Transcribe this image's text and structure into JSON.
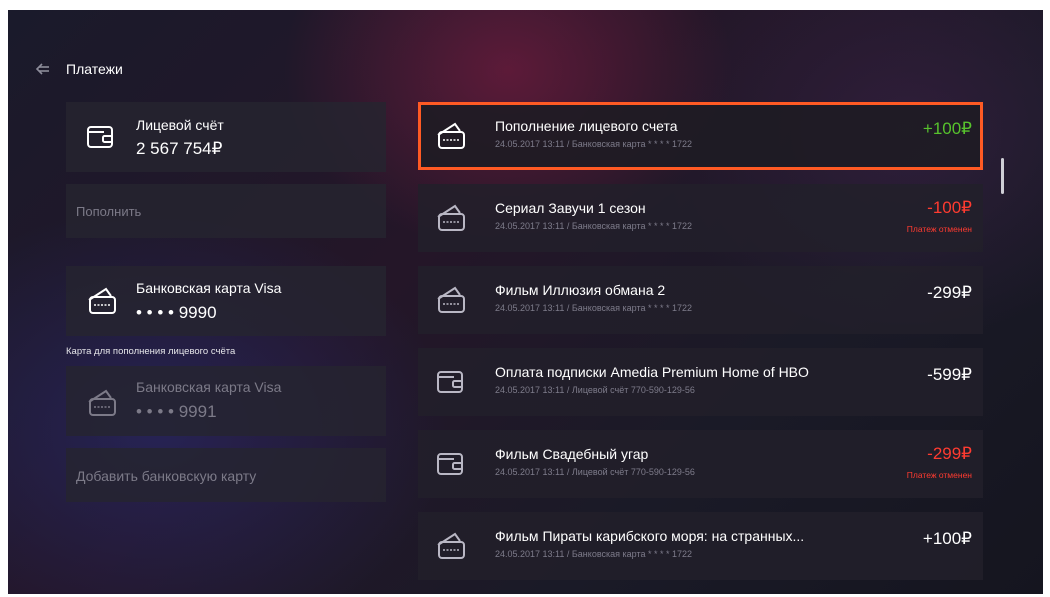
{
  "header": {
    "title": "Платежи"
  },
  "left": {
    "account": {
      "label": "Лицевой счёт",
      "balance": "2 567 754₽"
    },
    "topup_label": "Пополнить",
    "card_primary": {
      "name": "Банковская карта Visa",
      "number": "• • • • 9990"
    },
    "card_caption": "Карта для пополнения лицевого счёта",
    "card_secondary": {
      "name": "Банковская карта Visa",
      "number": "• • • • 9991"
    },
    "add_card_label": "Добавить банковскую карту"
  },
  "payments": [
    {
      "title": "Пополнение лицевого счета",
      "subtitle": "24.05.2017  13:11 / Банковская карта  * * * * 1722",
      "amount": "+100₽",
      "status": "",
      "icon": "bank-card-icon",
      "amount_color": "#57c22d",
      "selected": true
    },
    {
      "title": "Сериал Завучи 1 сезон",
      "subtitle": "24.05.2017  13:11 / Банковская карта  * * * * 1722",
      "amount": "-100₽",
      "status": "Платеж отменен",
      "icon": "bank-card-icon",
      "amount_color": "#ff3b30"
    },
    {
      "title": "Фильм Иллюзия обмана 2",
      "subtitle": "24.05.2017  13:11 / Банковская карта  * * * * 1722",
      "amount": "-299₽",
      "status": "",
      "icon": "bank-card-icon",
      "amount_color": "#ffffff"
    },
    {
      "title": "Оплата подписки Amedia Premium Home of HBO",
      "subtitle": "24.05.2017  13:11 / Лицевой счёт 770-590-129-56",
      "amount": "-599₽",
      "status": "",
      "icon": "wallet-icon",
      "amount_color": "#ffffff"
    },
    {
      "title": "Фильм Свадебный угар",
      "subtitle": "24.05.2017  13:11 / Лицевой счёт 770-590-129-56",
      "amount": "-299₽",
      "status": "Платеж отменен",
      "icon": "wallet-icon",
      "amount_color": "#ff3b30"
    },
    {
      "title": "Фильм Пираты карибского моря: на странных...",
      "subtitle": "24.05.2017  13:11 / Банковская карта  * * * * 1722",
      "amount": "+100₽",
      "status": "",
      "icon": "bank-card-icon",
      "amount_color": "#ffffff"
    }
  ],
  "colors": {
    "accent": "#ff5a24",
    "positive": "#57c22d",
    "negative": "#ff3b30"
  }
}
